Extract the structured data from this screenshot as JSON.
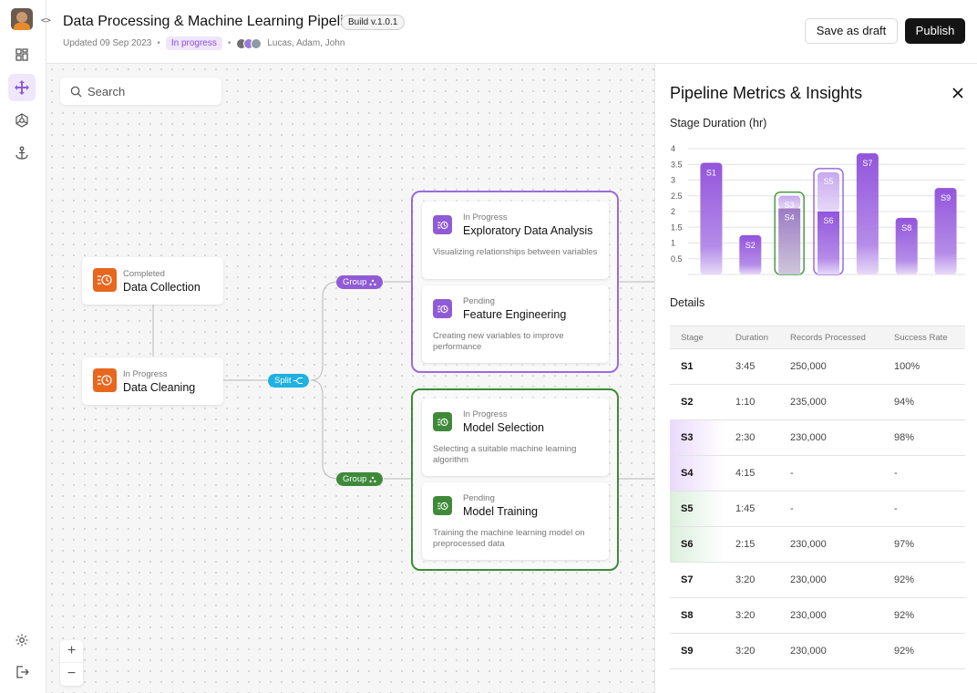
{
  "header": {
    "title": "Data Processing & Machine Learning Pipeline",
    "build": "Build v.1.0.1",
    "updated": "Updated 09 Sep 2023",
    "status": "In progress",
    "collaborators": "Lucas, Adam, John",
    "save_label": "Save as draft",
    "publish_label": "Publish"
  },
  "colors": {
    "accent_purple": "#8f5bd6",
    "accent_green": "#3f8a3a",
    "accent_orange": "#e8671f",
    "accent_cyan": "#1fb1e0"
  },
  "sidebar": {
    "items": [
      {
        "icon": "dashboard-grid-icon"
      },
      {
        "icon": "move-arrows-icon",
        "active": true
      },
      {
        "icon": "network-icon"
      },
      {
        "icon": "anchor-icon"
      }
    ],
    "bottom": [
      {
        "icon": "gear-icon"
      },
      {
        "icon": "logout-icon"
      }
    ]
  },
  "search": {
    "placeholder": "Search"
  },
  "nodes": {
    "collection": {
      "status": "Completed",
      "name": "Data Collection"
    },
    "cleaning": {
      "status": "In Progress",
      "name": "Data Cleaning"
    }
  },
  "tags": {
    "split": "Split",
    "group1": "Group",
    "group2": "Group"
  },
  "group_purple": {
    "cards": [
      {
        "status": "In Progress",
        "name": "Exploratory Data Analysis",
        "desc": "Visualizing relationships between variables"
      },
      {
        "status": "Pending",
        "name": "Feature Engineering",
        "desc": "Creating new variables to improve performance"
      }
    ]
  },
  "group_green": {
    "cards": [
      {
        "status": "In Progress",
        "name": "Model Selection",
        "desc": "Selecting a suitable machine learning algorithm"
      },
      {
        "status": "Pending",
        "name": "Model Training",
        "desc": "Training the machine learning model on preprocessed data"
      }
    ]
  },
  "zoom": {
    "in": "+",
    "out": "−"
  },
  "panel": {
    "title": "Pipeline Metrics & Insights",
    "chart_title": "Stage Duration (hr)",
    "details_title": "Details",
    "columns": [
      "Stage",
      "Duration",
      "Records Processed",
      "Success Rate"
    ],
    "rows": [
      {
        "stage": "S1",
        "duration": "3:45",
        "records": "250,000",
        "success": "100%"
      },
      {
        "stage": "S2",
        "duration": "1:10",
        "records": "235,000",
        "success": "94%"
      },
      {
        "stage": "S3",
        "duration": "2:30",
        "records": "230,000",
        "success": "98%",
        "highlight": "purple"
      },
      {
        "stage": "S4",
        "duration": "4:15",
        "records": "-",
        "success": "-",
        "highlight": "purple"
      },
      {
        "stage": "S5",
        "duration": "1:45",
        "records": "-",
        "success": "-",
        "highlight": "green"
      },
      {
        "stage": "S6",
        "duration": "2:15",
        "records": "230,000",
        "success": "97%",
        "highlight": "green"
      },
      {
        "stage": "S7",
        "duration": "3:20",
        "records": "230,000",
        "success": "92%"
      },
      {
        "stage": "S8",
        "duration": "3:20",
        "records": "230,000",
        "success": "92%"
      },
      {
        "stage": "S9",
        "duration": "3:20",
        "records": "230,000",
        "success": "92%"
      }
    ]
  },
  "chart_data": {
    "type": "bar",
    "title": "Stage Duration (hr)",
    "xlabel": "",
    "ylabel": "",
    "ylim": [
      0,
      4
    ],
    "yticks": [
      "0.5",
      "1",
      "1.5",
      "2",
      "2.5",
      "3",
      "3.5",
      "4"
    ],
    "grid": true,
    "categories": [
      "S1",
      "S2",
      "S3",
      "S4",
      "S5",
      "S6",
      "S7",
      "S8",
      "S9"
    ],
    "bars": [
      {
        "label": "S1",
        "value": 3.55
      },
      {
        "label": "S2",
        "value": 1.25
      },
      {
        "label": "S3",
        "value": 2.5,
        "stack_bottom": 2.1,
        "stack_top_label": "S3",
        "stack_bottom_label": "S4",
        "group": "green"
      },
      {
        "label": "S5",
        "value": 3.25,
        "stack_bottom": 2.0,
        "stack_top_label": "S5",
        "stack_bottom_label": "S6",
        "group": "purple"
      },
      {
        "label": "S7",
        "value": 3.85
      },
      {
        "label": "S8",
        "value": 1.8
      },
      {
        "label": "S9",
        "value": 2.75
      }
    ]
  }
}
